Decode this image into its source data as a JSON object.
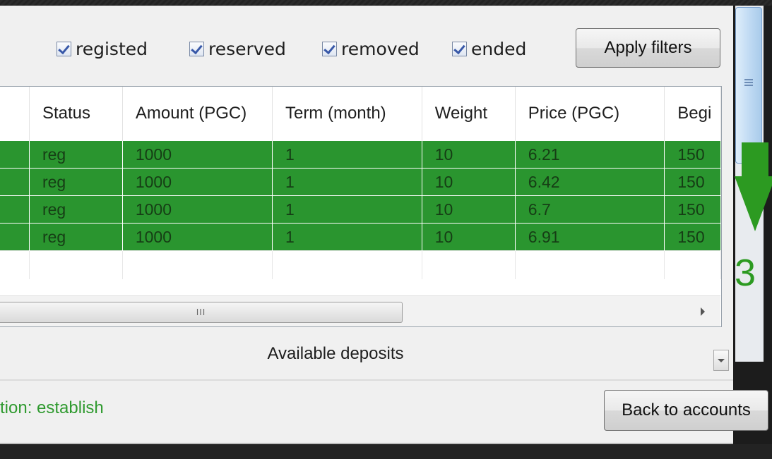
{
  "filters": {
    "checkboxes": [
      {
        "label": "registed",
        "checked": true
      },
      {
        "label": "reserved",
        "checked": true
      },
      {
        "label": "removed",
        "checked": true
      },
      {
        "label": "ended",
        "checked": true
      }
    ],
    "apply_label": "Apply filters"
  },
  "grid": {
    "columns": [
      "",
      "Status",
      "Amount (PGC)",
      "Term (month)",
      "Weight",
      "Price (PGC)",
      "Begi"
    ],
    "rows": [
      [
        "",
        "reg",
        "1000",
        "1",
        "10",
        "6.21",
        "150"
      ],
      [
        "",
        "reg",
        "1000",
        "1",
        "10",
        "6.42",
        "150"
      ],
      [
        "",
        "reg",
        "1000",
        "1",
        "10",
        "6.7",
        "150"
      ],
      [
        "",
        "reg",
        "1000",
        "1",
        "10",
        "6.91",
        "150"
      ]
    ],
    "row_color": "#2a952f",
    "scroll_grip": "III"
  },
  "caption": "Available deposits",
  "action_text": "tion: establish",
  "back_label": "Back to accounts",
  "annotation": {
    "step": "3",
    "color": "#2c9a21"
  }
}
